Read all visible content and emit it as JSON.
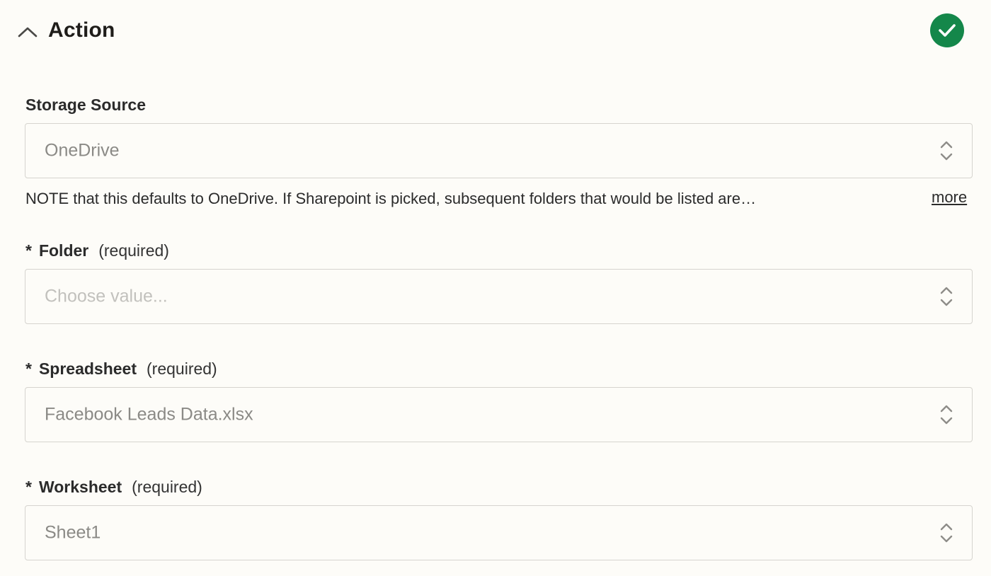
{
  "section": {
    "title": "Action",
    "status": "complete",
    "status_color": "#14874a"
  },
  "fields": {
    "storage_source": {
      "label": "Storage Source",
      "value": "OneDrive",
      "note": "NOTE that this defaults to OneDrive. If Sharepoint is picked, subsequent folders that would be listed are…",
      "more_label": "more"
    },
    "folder": {
      "asterisk": "*",
      "label": "Folder",
      "required_text": "(required)",
      "placeholder": "Choose value..."
    },
    "spreadsheet": {
      "asterisk": "*",
      "label": "Spreadsheet",
      "required_text": "(required)",
      "value": "Facebook Leads Data.xlsx"
    },
    "worksheet": {
      "asterisk": "*",
      "label": "Worksheet",
      "required_text": "(required)",
      "value": "Sheet1"
    }
  },
  "icons": {
    "collapse": "chevron-up-icon",
    "status": "check-circle-icon",
    "select": "chevron-up-down-icon"
  }
}
